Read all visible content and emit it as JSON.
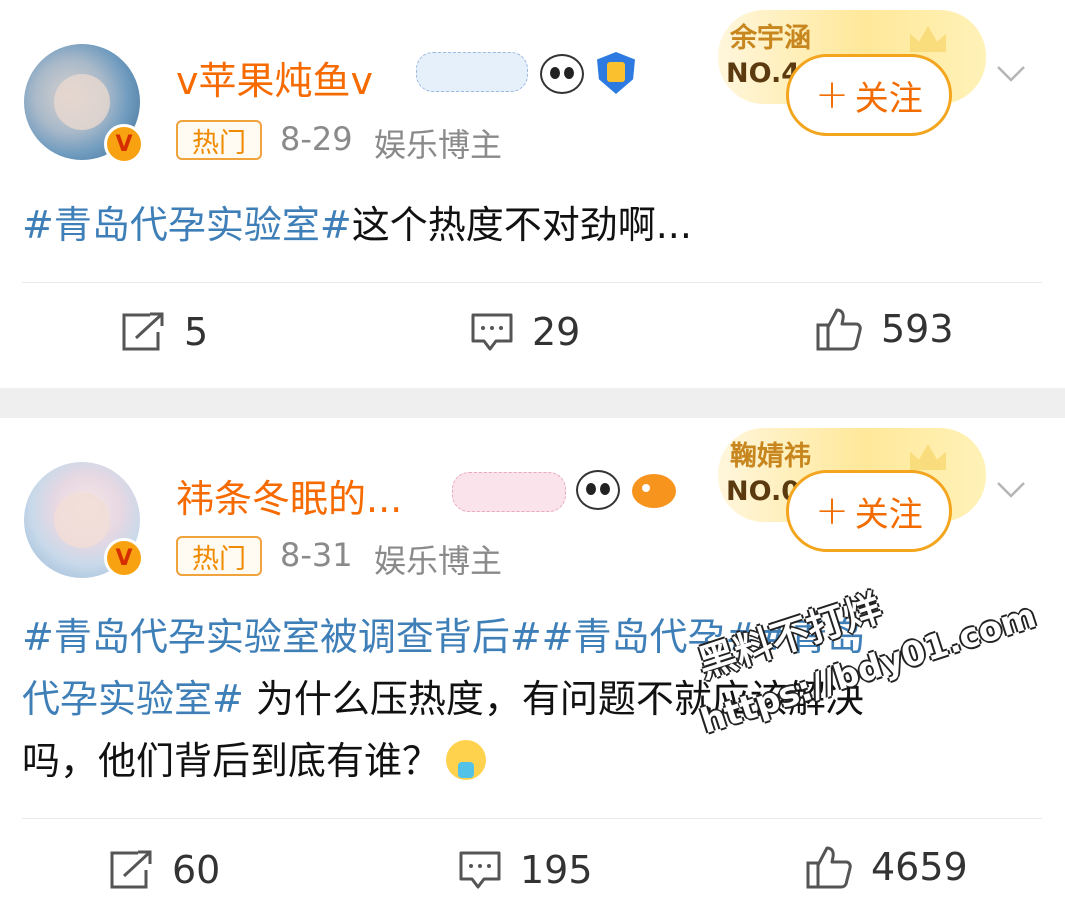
{
  "posts": [
    {
      "username": "v苹果炖鱼v",
      "hot_label": "热门",
      "date": "8-29",
      "category": "娱乐博主",
      "fan_card": {
        "name": "余宇涵",
        "rank": "NO.4"
      },
      "follow_label": "关注",
      "content": {
        "hashtags": [
          "#青岛代孕实验室#"
        ],
        "text": "这个热度不对劲啊..."
      },
      "stats": {
        "reposts": "5",
        "comments": "29",
        "likes": "593"
      }
    },
    {
      "username": "祎条冬眠的...",
      "hot_label": "热门",
      "date": "8-31",
      "category": "娱乐博主",
      "fan_card": {
        "name": "鞠婧祎",
        "rank": "NO.0"
      },
      "follow_label": "关注",
      "content": {
        "hashtag_line_a": "#青岛代孕实验室被调查背后##青岛代孕##青岛",
        "hashtag_line_b": "代孕实验室#",
        "text_b": " 为什么压热度，有问题不就应该解决",
        "text_c": "吗，他们背后到底有谁？"
      },
      "stats": {
        "reposts": "60",
        "comments": "195",
        "likes": "4659"
      }
    }
  ],
  "watermark": {
    "line1": "黑料不打烊",
    "line2": "https://bdy01.com"
  },
  "colors": {
    "username": "#f66a00",
    "hashtag": "#3f7fb8",
    "follow_border": "#f3a51d",
    "separator": "#efefef"
  },
  "icons": [
    "verified-v-icon",
    "panda-emoji-icon",
    "shield-badge-icon",
    "fish-emoji-icon",
    "chevron-down-icon",
    "repost-icon",
    "comment-icon",
    "like-icon",
    "drool-emoji-icon"
  ]
}
